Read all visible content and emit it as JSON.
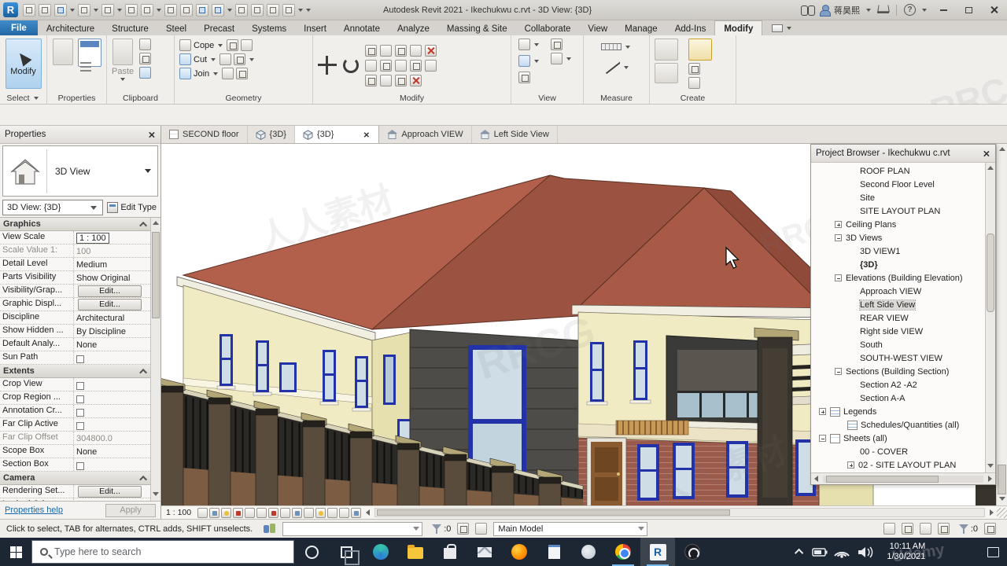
{
  "colors": {
    "roof_light": "#b2604b",
    "roof_dark": "#9b5240",
    "roof_mid": "#a85a46",
    "roof_side": "#8f4a3a",
    "wall": "#f0ebc2",
    "wall_shade": "#e6dfae",
    "accent_dark": "#4e4c48",
    "window_frame": "#2233aa",
    "glass": "#cfdde6",
    "brick": "#9a5a4c",
    "cornice": "#f1eee2",
    "fence_dark": "#2b2926",
    "pillar_cap": "#b3a677",
    "file_tab_blue": "#2e7cc0",
    "taskbar_bg": "#1d2633"
  },
  "titlebar": {
    "logo": "R",
    "title": "Autodesk Revit 2021 - Ikechukwu c.rvt - 3D View: {3D}",
    "user": "蒋昊熙",
    "help_glyph": "?"
  },
  "ribbon": {
    "tabs": [
      "File",
      "Architecture",
      "Structure",
      "Steel",
      "Precast",
      "Systems",
      "Insert",
      "Annotate",
      "Analyze",
      "Massing & Site",
      "Collaborate",
      "View",
      "Manage",
      "Add-Ins",
      "Modify"
    ],
    "modify_button": "Modify",
    "paste": "Paste",
    "cope": "Cope",
    "cut": "Cut",
    "join": "Join",
    "panels": {
      "select": "Select",
      "properties": "Properties",
      "clipboard": "Clipboard",
      "geometry": "Geometry",
      "modify": "Modify",
      "view": "View",
      "measure": "Measure",
      "create": "Create"
    }
  },
  "view_tabs": {
    "t1": "SECOND floor",
    "t2": "{3D}",
    "t3": "{3D}",
    "t4": "Approach  VIEW",
    "t5": "Left Side View"
  },
  "properties": {
    "title": "Properties",
    "type_name": "3D View",
    "instance": "3D View: {3D}",
    "edit_type": "Edit Type",
    "sec_graphics": "Graphics",
    "sec_extents": "Extents",
    "sec_camera": "Camera",
    "graphics_rows": [
      {
        "label": "View Scale",
        "value": "1 : 100"
      },
      {
        "label": "Scale Value    1:",
        "value": "100"
      },
      {
        "label": "Detail Level",
        "value": "Medium"
      },
      {
        "label": "Parts Visibility",
        "value": "Show Original"
      },
      {
        "label": "Visibility/Grap...",
        "value": "Edit..."
      },
      {
        "label": "Graphic Displ...",
        "value": "Edit..."
      },
      {
        "label": "Discipline",
        "value": "Architectural"
      },
      {
        "label": "Show Hidden ...",
        "value": "By Discipline"
      },
      {
        "label": "Default Analy...",
        "value": "None"
      },
      {
        "label": "Sun Path",
        "value": ""
      }
    ],
    "extents_rows": [
      {
        "label": "Crop View",
        "value": ""
      },
      {
        "label": "Crop Region ...",
        "value": ""
      },
      {
        "label": "Annotation Cr...",
        "value": ""
      },
      {
        "label": "Far Clip Active",
        "value": ""
      },
      {
        "label": "Far Clip Offset",
        "value": "304800.0"
      },
      {
        "label": "Scope Box",
        "value": "None"
      },
      {
        "label": "Section Box",
        "value": ""
      }
    ],
    "camera_rows": [
      {
        "label": "Rendering Set...",
        "value": "Edit..."
      },
      {
        "label": "Locked Orient...",
        "value": ""
      }
    ],
    "help": "Properties help",
    "apply": "Apply"
  },
  "browser": {
    "title": "Project Browser - Ikechukwu c.rvt",
    "items": [
      {
        "label": "ROOF PLAN"
      },
      {
        "label": "Second Floor Level"
      },
      {
        "label": "Site"
      },
      {
        "label": "SITE LAYOUT PLAN"
      },
      {
        "label": "Ceiling Plans"
      },
      {
        "label": "3D Views"
      },
      {
        "label": "3D VIEW1"
      },
      {
        "label": "{3D}"
      },
      {
        "label": "Elevations (Building Elevation)"
      },
      {
        "label": "Approach  VIEW"
      },
      {
        "label": "Left Side View"
      },
      {
        "label": "REAR  VIEW"
      },
      {
        "label": "Right side VIEW"
      },
      {
        "label": "South"
      },
      {
        "label": "SOUTH-WEST VIEW"
      },
      {
        "label": "Sections (Building Section)"
      },
      {
        "label": "Section A2 -A2"
      },
      {
        "label": "Section A-A"
      },
      {
        "label": "Legends"
      },
      {
        "label": "Schedules/Quantities (all)"
      },
      {
        "label": "Sheets (all)"
      },
      {
        "label": "00 - COVER"
      },
      {
        "label": "02 - SITE LAYOUT PLAN"
      }
    ]
  },
  "vcb": {
    "scale": "1 : 100"
  },
  "status": {
    "hint": "Click to select, TAB for alternates, CTRL adds, SHIFT unselects.",
    "filter_count": ":0",
    "filter_count2": ":0",
    "main_model": "Main Model"
  },
  "taskbar": {
    "search": "Type here to search",
    "revit_letter": "R",
    "time": "10:11 AM",
    "date": "1/30/2021"
  },
  "watermarks": {
    "w1": "人人素材",
    "w2": "RRCG",
    "w3": "人人素材",
    "w4": "RRCG",
    "w5": "Udemy"
  }
}
